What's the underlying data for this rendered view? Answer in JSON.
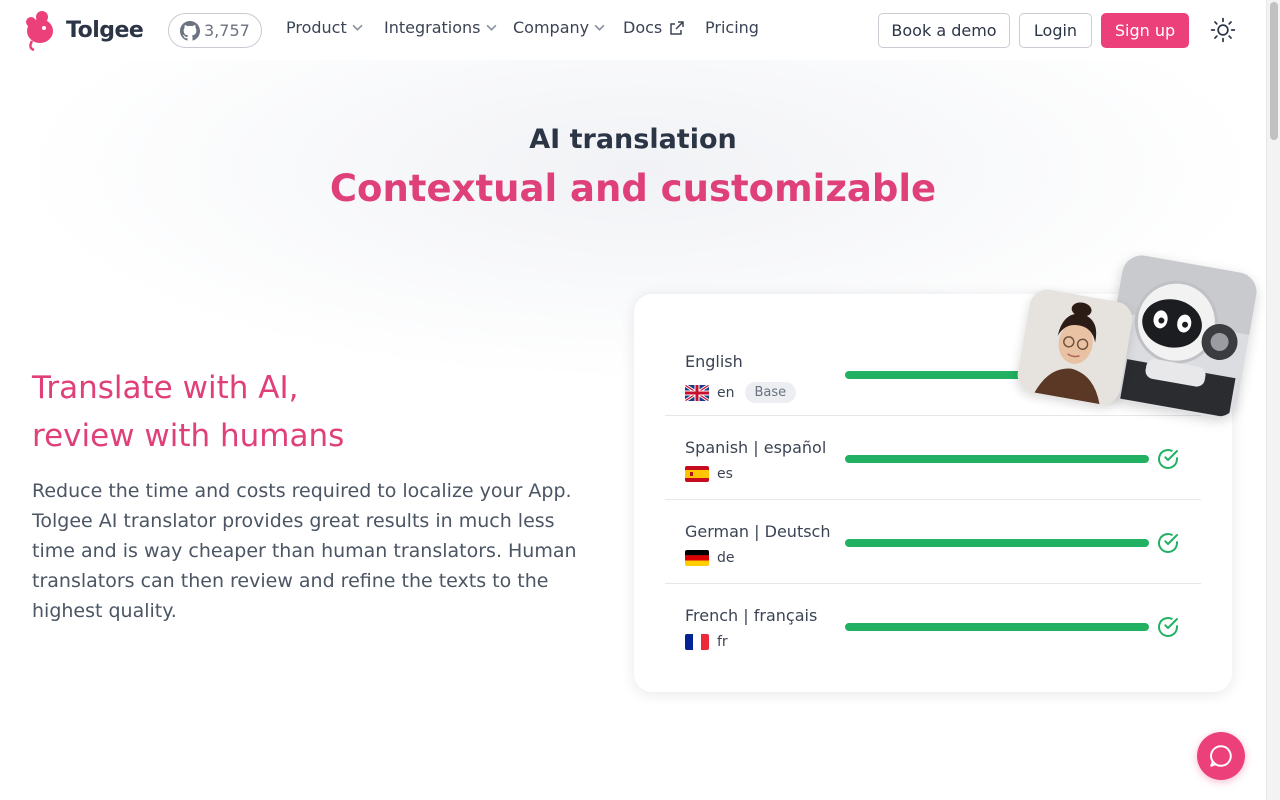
{
  "nav": {
    "brand": "Tolgee",
    "github_stars": "3,757",
    "menu": [
      {
        "label": "Product"
      },
      {
        "label": "Integrations"
      },
      {
        "label": "Company"
      },
      {
        "label": "Docs"
      },
      {
        "label": "Pricing"
      }
    ],
    "book_demo": "Book a demo",
    "login": "Login",
    "signup": "Sign up"
  },
  "hero": {
    "subtitle": "AI translation",
    "title": "Contextual and customizable"
  },
  "feature": {
    "title_line1": "Translate with AI,",
    "title_line2": "review with humans",
    "description": "Reduce the time and costs required to localize your App. Tolgee AI translator provides great results in much less time and is way cheaper than human translators. Human translators can then review and refine the texts to the highest quality."
  },
  "languages": [
    {
      "name": "English",
      "code": "en",
      "badge": "Base",
      "progress": 1.0,
      "done": false
    },
    {
      "name": "Spanish | español",
      "code": "es",
      "progress": 1.0,
      "done": true
    },
    {
      "name": "German | Deutsch",
      "code": "de",
      "progress": 1.0,
      "done": true
    },
    {
      "name": "French | français",
      "code": "fr",
      "progress": 1.0,
      "done": true
    }
  ],
  "colors": {
    "brand": "#ec407a",
    "progress": "#22b162",
    "text": "#3b4454"
  },
  "icons": {
    "logo": "mouse-logo-icon",
    "github": "github-icon",
    "theme": "sun-icon",
    "chat": "chat-bubble-icon",
    "check": "check-circle-icon"
  }
}
